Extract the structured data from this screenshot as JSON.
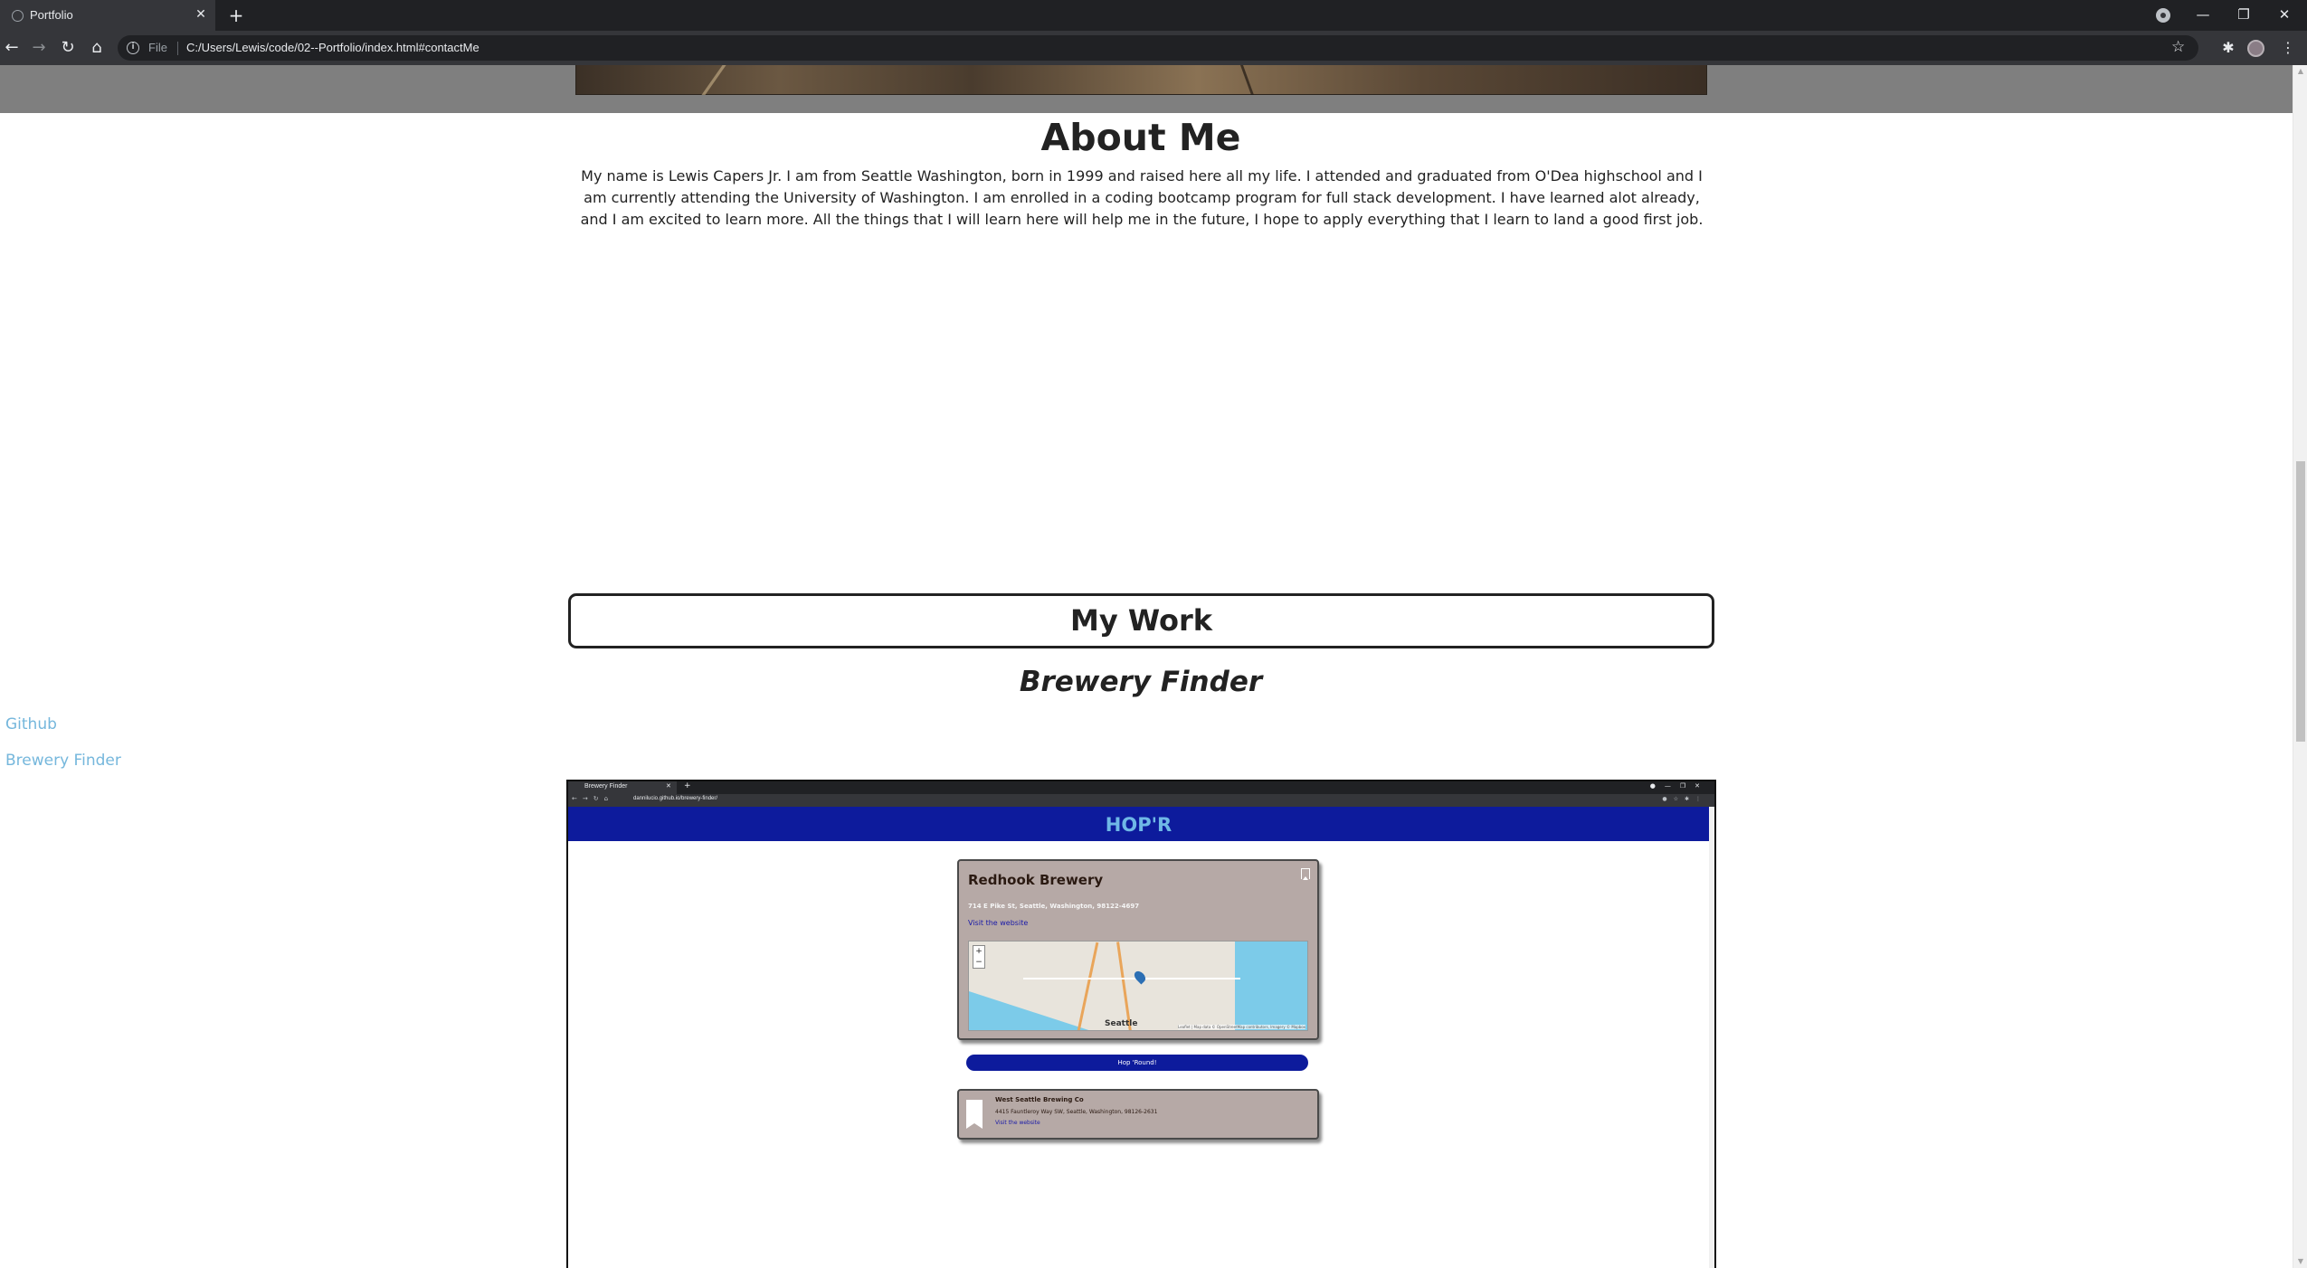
{
  "browser": {
    "tab_title": "Portfolio",
    "tab_close": "✕",
    "new_tab": "+",
    "scheme_label": "File",
    "url": "C:/Users/Lewis/code/02--Portfolio/index.html#contactMe",
    "window_controls": {
      "minimize": "—",
      "restore": "❐",
      "close": "✕"
    }
  },
  "page": {
    "about": {
      "title": "About Me",
      "text": "My name is Lewis Capers Jr. I am from Seattle Washington, born in 1999 and raised here all my life. I attended and graduated from O'Dea highschool and I am currently attending the University of Washington. I am enrolled in a coding bootcamp program for full stack development. I have learned alot already, and I am excited to learn more. All the things that I will learn here will help me in the future, I hope to apply everything that I learn to land a good first job."
    },
    "my_work": {
      "title": "My Work"
    },
    "project": {
      "title": "Brewery Finder"
    },
    "side_links": [
      "Github",
      "Brewery Finder"
    ]
  },
  "screenshot": {
    "tab_title": "Brewery Finder",
    "url": "dannilucio.github.io/brewery-finder/",
    "logo": "HOP'R",
    "main_card": {
      "name": "Redhook Brewery",
      "address": "714 E Pike St, Seattle, Washington, 98122-4697",
      "link": "Visit the website",
      "map_city": "Seattle",
      "map_attrib": "Leaflet | Map data © OpenStreetMap contributors, Imagery © Mapbox"
    },
    "hop_button": "Hop 'Round!",
    "saved_card": {
      "name": "West Seattle Brewing Co",
      "address": "4415 Fauntleroy Way SW, Seattle, Washington, 98126-2631",
      "link": "Visit the website"
    }
  },
  "colors": {
    "link": "#75b7dc",
    "header_blue": "#0d1b9c",
    "card_bg": "#b6a9a6"
  }
}
